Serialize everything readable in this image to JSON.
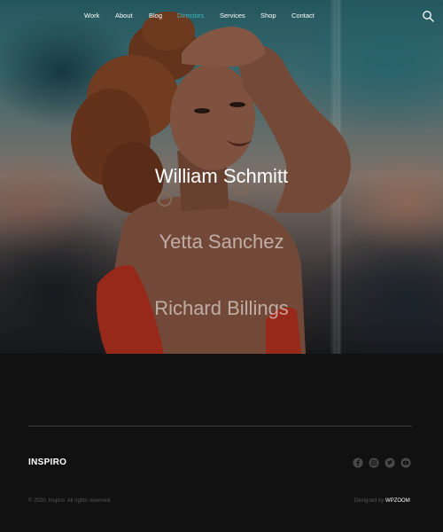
{
  "nav": {
    "items": [
      {
        "label": "Work",
        "active": false
      },
      {
        "label": "About",
        "active": false
      },
      {
        "label": "Blog",
        "active": false
      },
      {
        "label": "Directors",
        "active": true
      },
      {
        "label": "Services",
        "active": false
      },
      {
        "label": "Shop",
        "active": false
      },
      {
        "label": "Contact",
        "active": false
      }
    ],
    "search_icon": "search-icon",
    "active_color": "#3fb8c2"
  },
  "hero": {
    "names": [
      "William Schmitt",
      "Yetta Sanchez",
      "Richard Billings"
    ],
    "highlighted_name": "William Schmitt"
  },
  "footer": {
    "brand": "INSPIRO",
    "social_icons": [
      "facebook-icon",
      "instagram-icon",
      "twitter-icon",
      "youtube-icon"
    ],
    "copyright": "© 2020, Inspiro. All rights reserved.",
    "credit_prefix": "Designed by",
    "credit_brand": "WPZOOM"
  }
}
